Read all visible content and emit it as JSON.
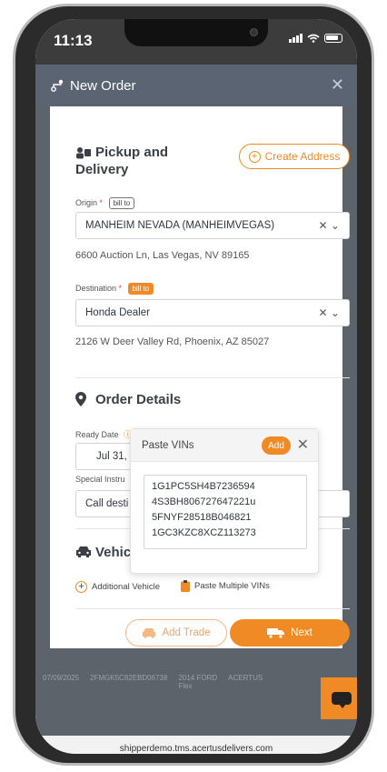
{
  "status": {
    "time": "11:13"
  },
  "modal": {
    "title": "New Order"
  },
  "pickup": {
    "title_line1": "Pickup and",
    "title_line2": "Delivery",
    "create_address_label": "Create Address",
    "origin_label": "Origin",
    "origin_required": "*",
    "origin_tag": "bill to",
    "origin_value": "MANHEIM NEVADA (MANHEIMVEGAS)",
    "origin_address": "6600 Auction Ln, Las Vegas, NV 89165",
    "destination_label": "Destination",
    "destination_required": "*",
    "destination_tag": "bill to",
    "destination_value": "Honda Dealer",
    "destination_address": "2126 W Deer Valley Rd, Phoenix, AZ 85027"
  },
  "order_details": {
    "title": "Order Details",
    "ready_date_label": "Ready Date",
    "ready_date_value": "Jul 31,",
    "special_label": "Special Instru",
    "special_value": "Call desti"
  },
  "vehicles": {
    "title": "Vehicle",
    "additional_vehicle_label": "Additional Vehicle",
    "paste_multiple_label": "Paste Multiple VINs"
  },
  "popover": {
    "title": "Paste VINs",
    "add_label": "Add",
    "vins": [
      "1G1PC5SH4B7236594",
      "4S3BH806727647221u",
      "5FNYF28518B046821",
      "1GC3KZC8XCZ113273"
    ]
  },
  "footer": {
    "add_trade_label": "Add Trade",
    "next_label": "Next"
  },
  "background_row": {
    "date": "07/09/2025",
    "vin": "2FMGK5C82EBD06738",
    "vehicle": "2014 FORD",
    "model": "Flex",
    "carrier": "ACERTUS"
  },
  "browser": {
    "url": "shipperdemo.tms.acertusdelivers.com"
  },
  "colors": {
    "accent": "#f08a24",
    "header": "#5a6472"
  }
}
